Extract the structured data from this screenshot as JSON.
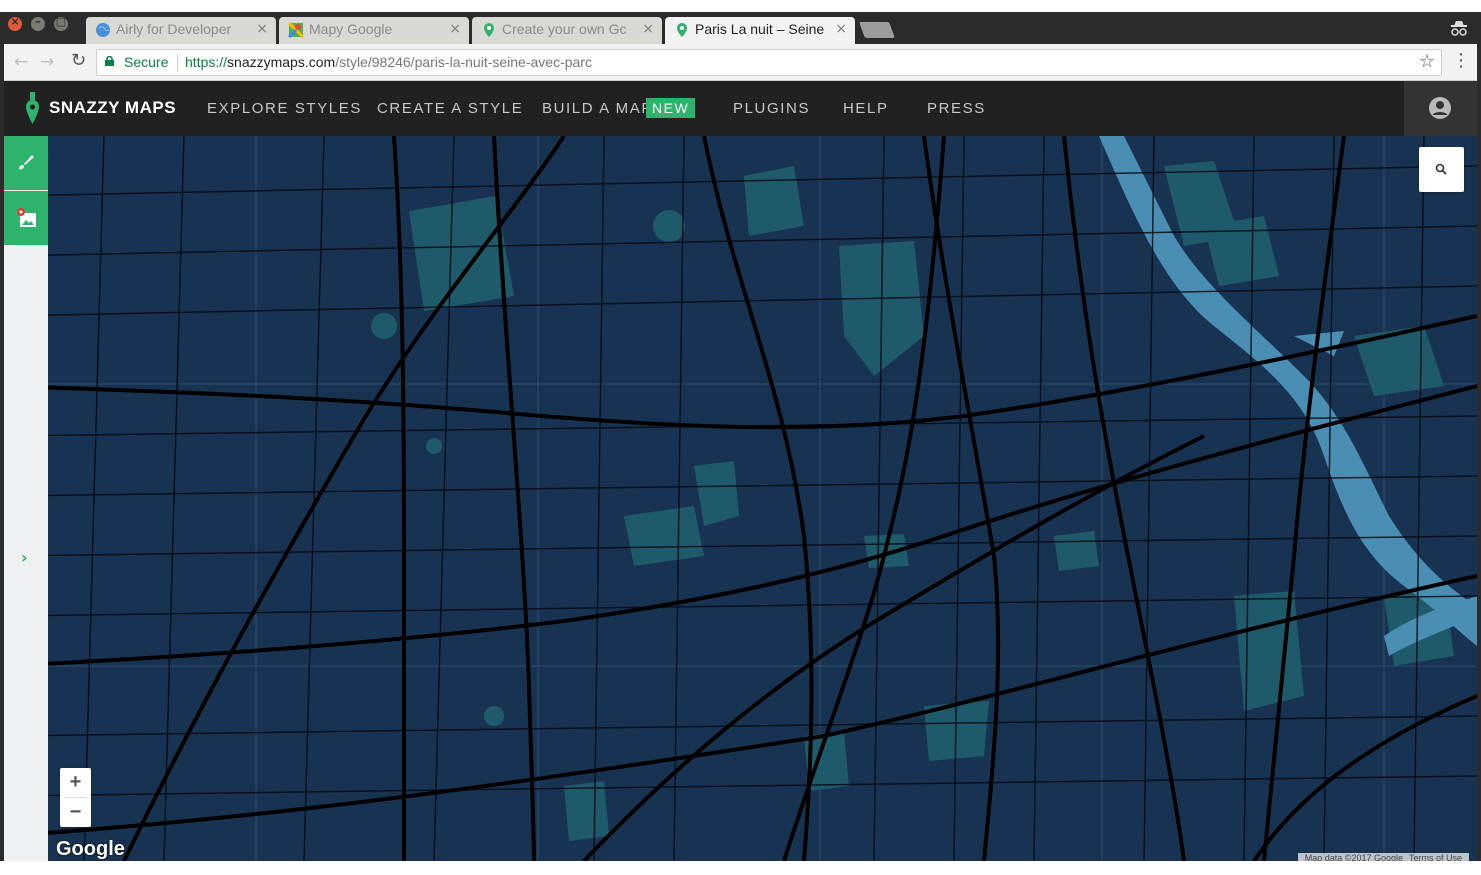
{
  "browser": {
    "tabs": [
      {
        "title": "Airly for Developer",
        "icon": "globe-icon",
        "active": false
      },
      {
        "title": "Mapy Google",
        "icon": "google-maps-icon",
        "active": false
      },
      {
        "title": "Create your own Gc",
        "icon": "map-pin-icon",
        "active": false
      },
      {
        "title": "Paris La nuit – Seine",
        "icon": "map-pin-icon",
        "active": true
      }
    ],
    "tab_close": "×",
    "secure_label": "Secure",
    "url_proto": "https://",
    "url_host": "snazzymaps.com",
    "url_path": "/style/98246/paris-la-nuit-seine-avec-parc",
    "star": "☆",
    "menu": "⋮",
    "back": "←",
    "forward": "→",
    "reload": "↻"
  },
  "site": {
    "brand": "SNAZZY MAPS",
    "nav": {
      "explore": "EXPLORE STYLES",
      "create": "CREATE A STYLE",
      "build": "BUILD A MAP",
      "build_badge": "NEW",
      "plugins": "PLUGINS",
      "help": "HELP",
      "press": "PRESS"
    },
    "accent_color": "#2db36b",
    "nav_bg": "#212121"
  },
  "map": {
    "expand": "›",
    "zoom_in": "+",
    "zoom_out": "−",
    "google_logo": "Google",
    "attribution": [
      "Map data ©2017 Google",
      "Terms of Use"
    ],
    "colors": {
      "land": "#183352",
      "road": "#000000",
      "water": "#4a8fb3",
      "park": "#1f5a6b"
    }
  }
}
